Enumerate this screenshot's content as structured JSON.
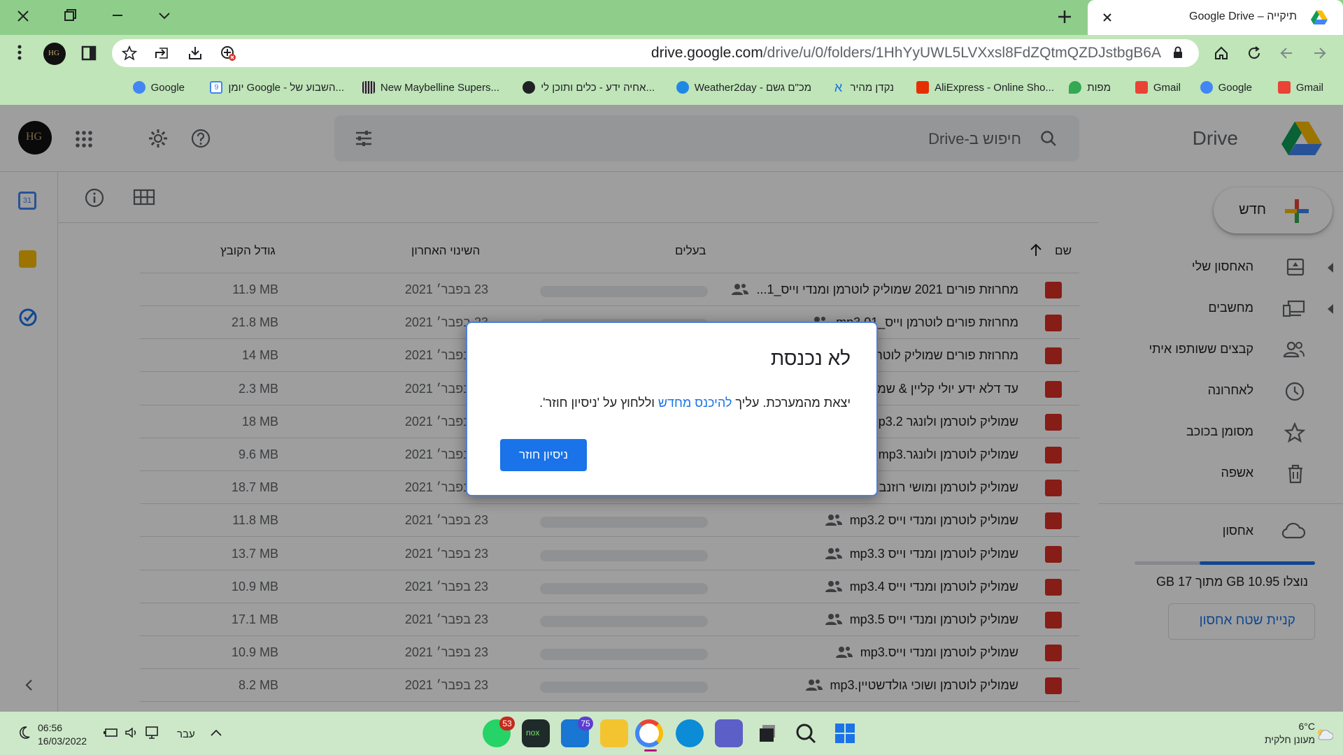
{
  "browser": {
    "tab_title": "תיקייה – Google Drive",
    "url_host": "drive.google.com",
    "url_path": "/drive/u/0/folders/1HhYyUWL5LVXxsl8FdZQtmQZDJstbgB6A",
    "bookmarks": [
      {
        "label": "Gmail",
        "icon": "gmail-icon",
        "color": "#ea4335"
      },
      {
        "label": "Google",
        "icon": "google-icon",
        "color": "#4285f4"
      },
      {
        "label": "Gmail",
        "icon": "gmail-icon",
        "color": "#ea4335"
      },
      {
        "label": "מפות",
        "icon": "maps-icon",
        "color": "#34a853"
      },
      {
        "label": "AliExpress - Online Sho...",
        "icon": "aliexpress-icon",
        "color": "#e62e04"
      },
      {
        "label": "נקדן מהיר",
        "icon": "nakdan-icon",
        "color": "#1a73e8"
      },
      {
        "label": "Weather2day - מכ\"ם גשם",
        "icon": "weather-icon",
        "color": "#1e88e5"
      },
      {
        "label": "אחיה ידע - כלים ותוכן לי...",
        "icon": "globe-icon",
        "color": "#202124"
      },
      {
        "label": "New Maybelline Supers...",
        "icon": "maybelline-icon",
        "color": "#444444"
      },
      {
        "label": "יומן Google - השבוע של...",
        "icon": "calendar-icon",
        "color": "#4285f4"
      },
      {
        "label": "Google",
        "icon": "google-icon",
        "color": "#4285f4"
      }
    ]
  },
  "drive": {
    "logo": "Drive",
    "search_placeholder": "חיפוש ב-Drive",
    "new_label": "חדש",
    "nav": [
      {
        "label": "האחסון שלי",
        "icon": "my-drive-icon"
      },
      {
        "label": "מחשבים",
        "icon": "computers-icon"
      },
      {
        "label": "קבצים ששותפו איתי",
        "icon": "shared-icon"
      },
      {
        "label": "לאחרונה",
        "icon": "clock-icon"
      },
      {
        "label": "מסומן בכוכב",
        "icon": "star-icon"
      },
      {
        "label": "אשפה",
        "icon": "trash-icon"
      }
    ],
    "storage_label": "אחסון",
    "storage_text": "נוצלו 10.95 GB מתוך 17 GB",
    "storage_used_fraction": 0.64,
    "buy_storage": "קניית שטח אחסון",
    "columns": {
      "name": "שם",
      "owner": "בעלים",
      "modified": "השינוי האחרון",
      "size": "גודל הקובץ"
    },
    "files": [
      {
        "name": "מחרוזת פורים 2021 שמוליק לוטרמן ומנדי וייס_1...",
        "date": "23 בפבר׳ 2021",
        "size": "11.9 MB",
        "shared": true
      },
      {
        "name": "מחרוזת פורים לוטרמן וייס_01.mp3",
        "date": "23 בפבר׳ 2021",
        "size": "21.8 MB",
        "shared": true
      },
      {
        "name": "מחרוזת פורים שמוליק לוטרמן",
        "date": "23 בפבר׳ 2021",
        "size": "14 MB",
        "shared": false
      },
      {
        "name": "עד דלא ידע יולי קליין & שמוליק",
        "date": "23 בפבר׳ 2021",
        "size": "2.3 MB",
        "shared": false
      },
      {
        "name": "שמוליק לוטרמן ולונגר mp3.2",
        "date": "23 בפבר׳ 2021",
        "size": "18 MB",
        "shared": false
      },
      {
        "name": "שמוליק לוטרמן ולונגר.mp3",
        "date": "23 בפבר׳ 2021",
        "size": "9.6 MB",
        "shared": false
      },
      {
        "name": "שמוליק לוטרמן ומושי רוזנבר",
        "date": "23 בפבר׳ 2021",
        "size": "18.7 MB",
        "shared": false
      },
      {
        "name": "שמוליק לוטרמן ומנדי וייס mp3.2",
        "date": "23 בפבר׳ 2021",
        "size": "11.8 MB",
        "shared": true
      },
      {
        "name": "שמוליק לוטרמן ומנדי וייס mp3.3",
        "date": "23 בפבר׳ 2021",
        "size": "13.7 MB",
        "shared": true
      },
      {
        "name": "שמוליק לוטרמן ומנדי וייס mp3.4",
        "date": "23 בפבר׳ 2021",
        "size": "10.9 MB",
        "shared": true
      },
      {
        "name": "שמוליק לוטרמן ומנדי וייס mp3.5",
        "date": "23 בפבר׳ 2021",
        "size": "17.1 MB",
        "shared": true
      },
      {
        "name": "שמוליק לוטרמן ומנדי וייס.mp3",
        "date": "23 בפבר׳ 2021",
        "size": "10.9 MB",
        "shared": true
      },
      {
        "name": "שמוליק לוטרמן ושוכי גולדשטיין.mp3",
        "date": "23 בפבר׳ 2021",
        "size": "8.2 MB",
        "shared": true
      }
    ]
  },
  "dialog": {
    "title": "לא נכנסת",
    "body_before": "יצאת מהמערכת. עליך ",
    "body_link": "להיכנס מחדש",
    "body_after": " וללחוץ על 'ניסיון חוזר'.",
    "retry_label": "ניסיון חוזר"
  },
  "taskbar": {
    "time": "06:56",
    "date": "16/03/2022",
    "language": "עבר",
    "whatsapp_badge": "53",
    "mail_badge": "75",
    "temperature": "6°C",
    "weather": "מעונן חלקית"
  },
  "colors": {
    "accent": "#1a73e8",
    "chrome_green": "#8fce8a",
    "chrome_light": "#bfe5b8",
    "taskbar": "#cde8c8"
  }
}
